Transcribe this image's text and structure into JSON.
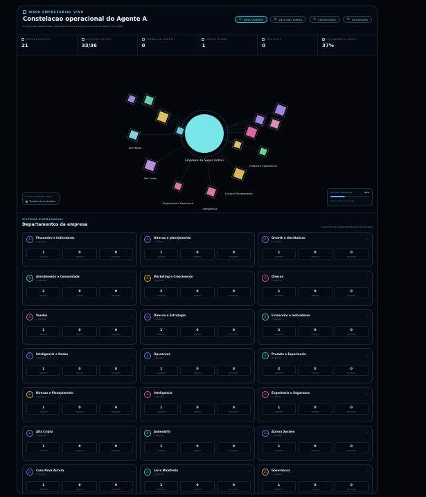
{
  "header": {
    "badge": "MAPA EMPRESARIAL VIVO",
    "title": "Constelacao operacional do Agente A",
    "subtitle": "A empresa orquestrada, departamentos e equipes em torno do agente principal.",
    "buttons": [
      {
        "label": "NOVO AGENTE",
        "icon": "plus-icon"
      },
      {
        "label": "DELEGAR TAREFA",
        "icon": "send-icon"
      },
      {
        "label": "EDITAR MAPA",
        "icon": "edit-icon"
      },
      {
        "label": "ORGANIZAR",
        "icon": "refresh-icon"
      }
    ]
  },
  "stats": [
    {
      "label": "DEPARTAMENTOS",
      "value": "21",
      "color": "#59d4e8"
    },
    {
      "label": "AGENTES ATIVOS",
      "value": "33/36",
      "color": "#59d4e8"
    },
    {
      "label": "TRABALHO ABERTO",
      "value": "0",
      "color": "#39d49a"
    },
    {
      "label": "METAS ATIVAS",
      "value": "1",
      "color": "#59d4e8"
    },
    {
      "label": "REVISOES",
      "value": "0",
      "color": "#59d4e8"
    },
    {
      "label": "ORCAMENTO USADO",
      "value": "37%",
      "color": "#59d4e8"
    }
  ],
  "map": {
    "center_label": "Empresa do Super Admin",
    "node_labels": [
      "Alfa Cripto",
      "Inteligencia",
      "Engenharia e Seguranca",
      "Livros e Planejamento",
      "Produto e Experiencia",
      "AnimeArth"
    ],
    "legend_left": {
      "title": "FLUXO OPERACIONAL",
      "item": "Tempo real conectado"
    },
    "legend_right": {
      "title": "USO DE CAPACIDADE",
      "value": "37%",
      "fraction": 0.37,
      "note": "Capacidade conectada"
    }
  },
  "departments": {
    "tag": "SISTEMA EMPRESARIAL",
    "title": "Departamentos da empresa",
    "hint": "Clique em um departamento para ver equipes",
    "col_labels": [
      "AGENTES",
      "TAREFAS",
      "REVISOES"
    ],
    "cards": [
      {
        "name": "Financeiro e Indicadores",
        "sub": "1 Agentes",
        "color": "#4a8bd4",
        "v": [
          "1",
          "0",
          "0"
        ]
      },
      {
        "name": "Direcao e planejamento",
        "sub": "1 Agentes",
        "color": "#8a6ad4",
        "v": [
          "1",
          "0",
          "0"
        ]
      },
      {
        "name": "Growth e distribuicao",
        "sub": "1 Agentes",
        "color": "#8a6ad4",
        "v": [
          "1",
          "0",
          "0"
        ]
      },
      {
        "name": "Atendimento e Comunidade",
        "sub": "2 Agentes",
        "color": "#39d49a",
        "v": [
          "2",
          "0",
          "0"
        ]
      },
      {
        "name": "Marketing e Crescimento",
        "sub": "2 Agentes",
        "color": "#e0a640",
        "v": [
          "2",
          "0",
          "0"
        ]
      },
      {
        "name": "Direcao",
        "sub": "1 Agentes",
        "color": "#d45a8a",
        "v": [
          "1",
          "0",
          "0"
        ]
      },
      {
        "name": "Vendas",
        "sub": "1 Agentes",
        "color": "#d45a8a",
        "v": [
          "1",
          "0",
          "0"
        ]
      },
      {
        "name": "Direcao e Estrategia",
        "sub": "1 Agentes",
        "color": "#8a6ad4",
        "v": [
          "1",
          "0",
          "0"
        ]
      },
      {
        "name": "Financeiro e Indicadores",
        "sub": "2 Agentes",
        "color": "#4ac0d4",
        "v": [
          "2",
          "0",
          "0"
        ]
      },
      {
        "name": "Inteligencia e Dados",
        "sub": "1 Agentes",
        "color": "#8a6ad4",
        "v": [
          "1",
          "0",
          "0"
        ]
      },
      {
        "name": "Operacoes",
        "sub": "1 Agentes",
        "color": "#4a8bd4",
        "v": [
          "1",
          "0",
          "0"
        ]
      },
      {
        "name": "Produto e Experiencia",
        "sub": "2 Agentes",
        "color": "#39d49a",
        "v": [
          "2",
          "0",
          "0"
        ]
      },
      {
        "name": "Direcao e Planejamento",
        "sub": "1 Agentes",
        "color": "#e0a640",
        "v": [
          "1",
          "0",
          "0"
        ]
      },
      {
        "name": "Inteligencia",
        "sub": "1 Agentes",
        "color": "#d45a8a",
        "v": [
          "1",
          "0",
          "0"
        ]
      },
      {
        "name": "Engenharia e Seguranca",
        "sub": "1 Agentes",
        "color": "#d45a8a",
        "v": [
          "1",
          "0",
          "0"
        ]
      },
      {
        "name": "Alfa Cripto",
        "sub": "1 Agentes",
        "color": "#8a6ad4",
        "v": [
          "1",
          "0",
          "0"
        ]
      },
      {
        "name": "AnimeArth",
        "sub": "1 Agentes",
        "color": "#4ac0d4",
        "v": [
          "1",
          "0",
          "0"
        ]
      },
      {
        "name": "Aurora System",
        "sub": "1 Agentes",
        "color": "#8a6ad4",
        "v": [
          "1",
          "0",
          "0"
        ]
      },
      {
        "name": "Casa Nova Aurora",
        "sub": "1 Agentes",
        "color": "#4a8bd4",
        "v": [
          "1",
          "0",
          "0"
        ]
      },
      {
        "name": "Livro Manifesto",
        "sub": "1 Agentes",
        "color": "#39d49a",
        "v": [
          "1",
          "0",
          "0"
        ]
      },
      {
        "name": "Governanca",
        "sub": "1 Agentes",
        "color": "#e0a640",
        "v": [
          "1",
          "0",
          "0"
        ]
      }
    ]
  }
}
